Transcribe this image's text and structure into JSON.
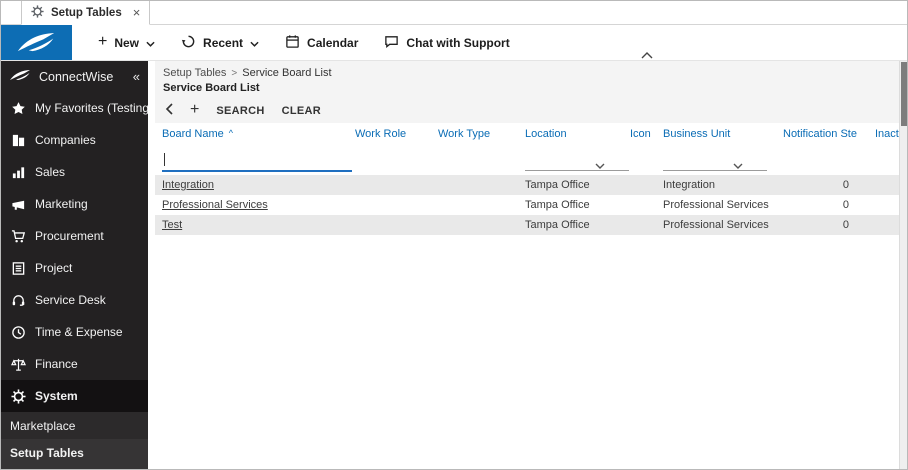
{
  "tab": {
    "title": "Setup Tables",
    "close": "×"
  },
  "topbar": {
    "new": "New",
    "recent": "Recent",
    "calendar": "Calendar",
    "chat": "Chat with Support"
  },
  "sidebar": {
    "brand": "ConnectWise",
    "collapse": "«",
    "items": [
      {
        "label": "My Favorites (Testing"
      },
      {
        "label": "Companies"
      },
      {
        "label": "Sales"
      },
      {
        "label": "Marketing"
      },
      {
        "label": "Procurement"
      },
      {
        "label": "Project"
      },
      {
        "label": "Service Desk"
      },
      {
        "label": "Time & Expense"
      },
      {
        "label": "Finance"
      },
      {
        "label": "System"
      }
    ],
    "subitems": [
      {
        "label": "Marketplace"
      },
      {
        "label": "Setup Tables"
      }
    ]
  },
  "content": {
    "breadcrumb": {
      "parent": "Setup Tables",
      "separator": ">",
      "current": "Service Board List"
    },
    "title": "Service Board List",
    "actions": {
      "search": "SEARCH",
      "clear": "CLEAR"
    }
  },
  "table": {
    "columns": [
      {
        "label": "Board Name",
        "sort": "^"
      },
      {
        "label": "Work Role"
      },
      {
        "label": "Work Type"
      },
      {
        "label": "Location"
      },
      {
        "label": "Icon"
      },
      {
        "label": "Business Unit"
      },
      {
        "label": "Notification Steps"
      },
      {
        "label": "Inactive"
      }
    ],
    "rows": [
      {
        "board_name": "Integration",
        "work_role": "",
        "work_type": "",
        "location": "Tampa Office",
        "icon": "",
        "business_unit": "Integration",
        "notification_steps": "0",
        "inactive": ""
      },
      {
        "board_name": "Professional Services",
        "work_role": "",
        "work_type": "",
        "location": "Tampa Office",
        "icon": "",
        "business_unit": "Professional Services",
        "notification_steps": "0",
        "inactive": ""
      },
      {
        "board_name": "Test",
        "work_role": "",
        "work_type": "",
        "location": "Tampa Office",
        "icon": "",
        "business_unit": "Professional Services",
        "notification_steps": "0",
        "inactive": ""
      }
    ]
  },
  "colors": {
    "brand_blue": "#0d6db4",
    "link_blue": "#0a6cb5",
    "sidebar_bg": "#232122",
    "header_gray": "#f4f4f4",
    "row_alt": "#e9e9e9",
    "filter_accent": "#1f6fc0"
  }
}
